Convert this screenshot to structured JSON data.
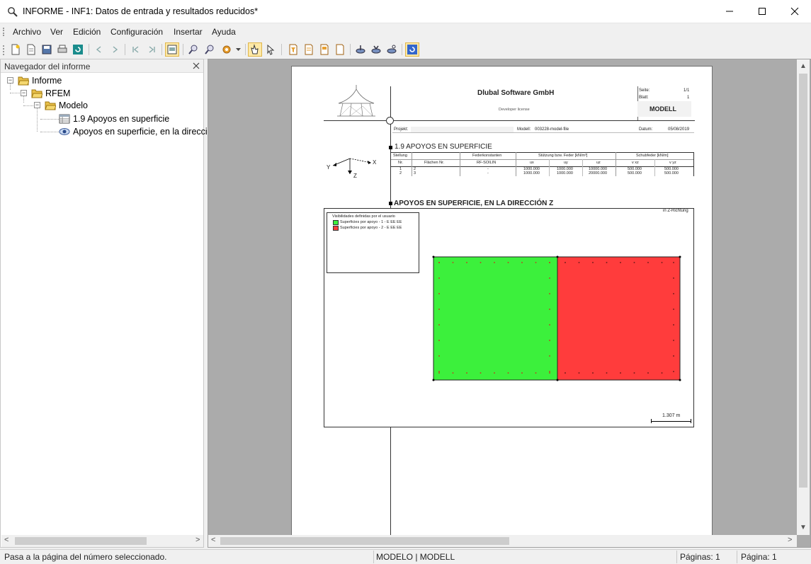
{
  "window": {
    "title": "INFORME - INF1: Datos de entrada y resultados reducidos*"
  },
  "menu": [
    "Archivo",
    "Ver",
    "Edición",
    "Configuración",
    "Insertar",
    "Ayuda"
  ],
  "navigator": {
    "title": "Navegador del informe",
    "tree": {
      "root": "Informe",
      "rfem": "RFEM",
      "model": "Modelo",
      "item1": "1.9 Apoyos en superficie",
      "item2": "Apoyos en superficie, en la dirección Z"
    }
  },
  "page": {
    "company": "Dlubal Software GmbH",
    "license": "Developer license",
    "seite_label": "Seite:",
    "seite_value": "1/1",
    "blatt_label": "Blatt:",
    "blatt_value": "1",
    "modell_box": "MODELL",
    "projekt_label": "Projekt:",
    "modell_label": "Modell:",
    "modell_value": "003228-model-file",
    "datum_label": "Datum:",
    "datum_value": "05/08/2019",
    "section1_title": "1.9 APOYOS EN SUPERFICIE",
    "axes": {
      "x": "X",
      "y": "Y",
      "z": "Z"
    },
    "table": {
      "head1": {
        "lager": "Stellung",
        "federkonst": "Federkonstanten",
        "stuetzung": "Stützung bzw. Feder [kN/m³]",
        "schub": "Schubfeder [kN/m]"
      },
      "head2": {
        "nr": "Nr.",
        "flaechen": "Flächen Nr.",
        "rfsoilin": "RF-SOILIN",
        "ux": "ux",
        "uy": "uy",
        "uz": "uz",
        "vxz": "v xz",
        "vyz": "v yz"
      },
      "rows": [
        {
          "nr": "1",
          "flaechen": "2",
          "rfsoilin": "-",
          "ux": "1000.000",
          "uy": "1000.000",
          "uz": "10000.000",
          "vxz": "500.000",
          "vyz": "500.000"
        },
        {
          "nr": "2",
          "flaechen": "3",
          "rfsoilin": "-",
          "ux": "1000.000",
          "uy": "1000.000",
          "uz": "20000.000",
          "vxz": "500.000",
          "vyz": "500.000"
        }
      ]
    },
    "section2_title": "APOYOS EN SUPERFICIE, EN LA DIRECCIÓN Z",
    "direction_note": "in Z-Richtung",
    "legend": {
      "title": "Visibilidades definidas por el usuario",
      "items": [
        {
          "label": "Superficies por apoyo - 1 - E EE EE",
          "color": "#3cf03c"
        },
        {
          "label": "Superficies por apoyo - 2 - E EE EE",
          "color": "#ff3c3c"
        }
      ]
    },
    "scale_label": "1.307 m"
  },
  "status": {
    "hint": "Pasa a la página del número seleccionado.",
    "mode": "MODELO | MODELL",
    "pages": "Páginas: 1",
    "page": "Página: 1"
  },
  "colors": {
    "surface1": "#3cf03c",
    "surface2": "#ff3c3c",
    "preview_bg": "#ababab",
    "folder": "#e8c04a"
  }
}
